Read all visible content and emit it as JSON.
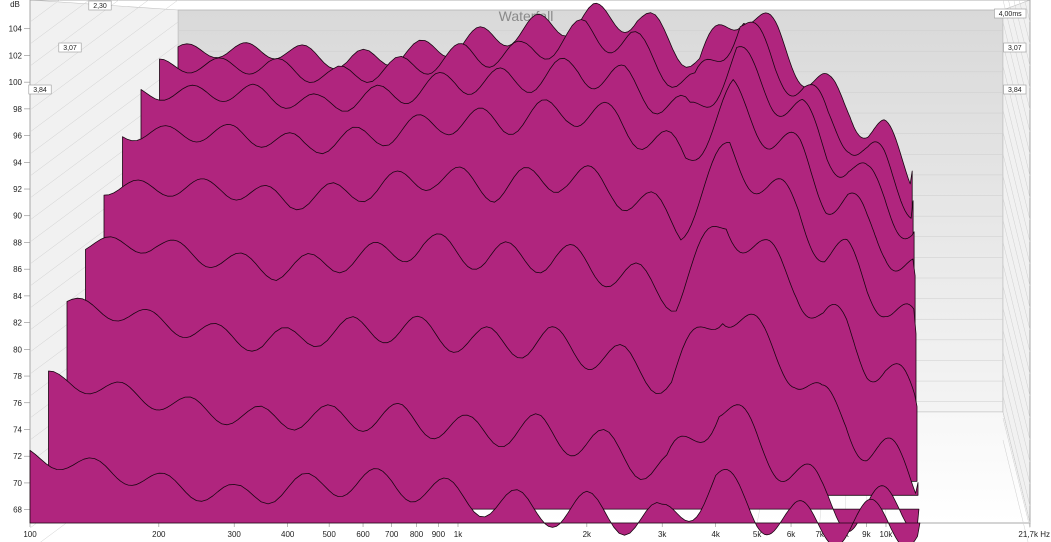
{
  "chart_data": {
    "type": "area",
    "title": "Waterfall",
    "y_unit_label": "dB",
    "x_unit_label": "Hz",
    "x_scale": "log",
    "xlim": [
      100,
      21700
    ],
    "ylim": [
      67,
      106
    ],
    "x_ticks": [
      {
        "value": 100,
        "label": "100"
      },
      {
        "value": 200,
        "label": "200"
      },
      {
        "value": 300,
        "label": "300"
      },
      {
        "value": 400,
        "label": "400"
      },
      {
        "value": 500,
        "label": "500"
      },
      {
        "value": 600,
        "label": "600"
      },
      {
        "value": 700,
        "label": "700"
      },
      {
        "value": 800,
        "label": "800"
      },
      {
        "value": 900,
        "label": "900"
      },
      {
        "value": 1000,
        "label": "1k"
      },
      {
        "value": 2000,
        "label": "2k"
      },
      {
        "value": 3000,
        "label": "3k"
      },
      {
        "value": 4000,
        "label": "4k"
      },
      {
        "value": 5000,
        "label": "5k"
      },
      {
        "value": 6000,
        "label": "6k"
      },
      {
        "value": 7000,
        "label": "7k"
      },
      {
        "value": 8000,
        "label": "8k"
      },
      {
        "value": 9000,
        "label": "9k"
      },
      {
        "value": 10000,
        "label": "10k"
      },
      {
        "value": 21700,
        "label": "21,7k Hz"
      }
    ],
    "y_ticks": [
      68,
      70,
      72,
      74,
      76,
      78,
      80,
      82,
      84,
      86,
      88,
      90,
      92,
      94,
      96,
      98,
      100,
      102,
      104
    ],
    "time_labels": [
      "2,30",
      "3,07",
      "3,84",
      "4,00ms",
      "3,07",
      "3,84"
    ],
    "time_range_ms": [
      0,
      4.0
    ],
    "slice_color": "#b0257e",
    "slice_outline_color": "#1a0612",
    "series": [
      {
        "time_ms": 4.0,
        "x": [
          100,
          150,
          200,
          300,
          500,
          700,
          1000,
          1500,
          2000,
          3000,
          4000,
          5000,
          6000,
          7000,
          8000,
          9000,
          10000,
          12000
        ],
        "values": [
          100,
          100,
          100,
          99,
          100,
          101,
          102,
          103,
          103,
          99,
          104,
          101,
          98,
          96,
          95,
          93,
          92,
          89
        ]
      },
      {
        "time_ms": 3.5,
        "x": [
          100,
          150,
          200,
          300,
          500,
          700,
          1000,
          1500,
          2000,
          3000,
          4000,
          5000,
          6000,
          7000,
          8000,
          9000,
          10000,
          12000
        ],
        "values": [
          99,
          99,
          99,
          98,
          99,
          100,
          100,
          102,
          101,
          97,
          103,
          99,
          97,
          94,
          93,
          91,
          90,
          87
        ]
      },
      {
        "time_ms": 3.0,
        "x": [
          100,
          150,
          200,
          300,
          500,
          700,
          1000,
          1500,
          2000,
          3000,
          4000,
          5000,
          6000,
          7000,
          8000,
          9000,
          10000,
          12000
        ],
        "values": [
          97,
          97,
          97,
          96,
          97,
          98,
          98,
          99,
          98,
          95,
          100,
          97,
          95,
          92,
          91,
          89,
          88,
          85
        ]
      },
      {
        "time_ms": 2.5,
        "x": [
          100,
          150,
          200,
          300,
          500,
          700,
          1000,
          1500,
          2000,
          3000,
          4000,
          5000,
          6000,
          7000,
          8000,
          9000,
          10000,
          12000
        ],
        "values": [
          94,
          94,
          94,
          93,
          94,
          95,
          95,
          96,
          95,
          92,
          97,
          94,
          92,
          89,
          88,
          86,
          85,
          82
        ]
      },
      {
        "time_ms": 2.0,
        "x": [
          100,
          150,
          200,
          300,
          500,
          700,
          1000,
          1500,
          2000,
          3000,
          4000,
          5000,
          6000,
          7000,
          8000,
          9000,
          10000,
          12000
        ],
        "values": [
          90,
          90,
          90,
          89,
          90,
          91,
          90,
          91,
          90,
          87,
          93,
          90,
          88,
          85,
          84,
          82,
          81,
          78
        ]
      },
      {
        "time_ms": 1.5,
        "x": [
          100,
          150,
          200,
          300,
          500,
          700,
          1000,
          1500,
          2000,
          3000,
          4000,
          5000,
          6000,
          7000,
          8000,
          9000,
          10000,
          12000
        ],
        "values": [
          86,
          86,
          85,
          84,
          85,
          86,
          85,
          85,
          84,
          82,
          88,
          85,
          83,
          80,
          79,
          77,
          76,
          73
        ]
      },
      {
        "time_ms": 1.0,
        "x": [
          100,
          150,
          200,
          300,
          500,
          700,
          1000,
          1500,
          2000,
          3000,
          4000,
          5000,
          6000,
          7000,
          8000,
          9000,
          10000,
          12000
        ],
        "values": [
          82,
          81,
          80,
          79,
          80,
          80,
          79,
          79,
          78,
          76,
          82,
          79,
          77,
          74,
          73,
          71,
          70,
          68
        ]
      },
      {
        "time_ms": 0.5,
        "x": [
          100,
          150,
          200,
          300,
          500,
          700,
          1000,
          1500,
          2000,
          3000,
          4000,
          5000,
          6000,
          7000,
          8000,
          9000,
          10000,
          12000
        ],
        "values": [
          77,
          76,
          75,
          74,
          74,
          74,
          73,
          73,
          72,
          70,
          75,
          72,
          70,
          68,
          67,
          67,
          67,
          67
        ]
      },
      {
        "time_ms": 0.0,
        "x": [
          100,
          150,
          200,
          300,
          500,
          700,
          1000,
          1500,
          2000,
          3000,
          4000,
          5000,
          6000,
          7000,
          8000,
          9000,
          10000,
          12000
        ],
        "values": [
          72,
          71,
          70,
          69,
          70,
          70,
          69,
          68,
          68,
          67,
          70,
          68,
          67,
          67,
          67,
          67,
          67,
          67
        ]
      }
    ]
  }
}
